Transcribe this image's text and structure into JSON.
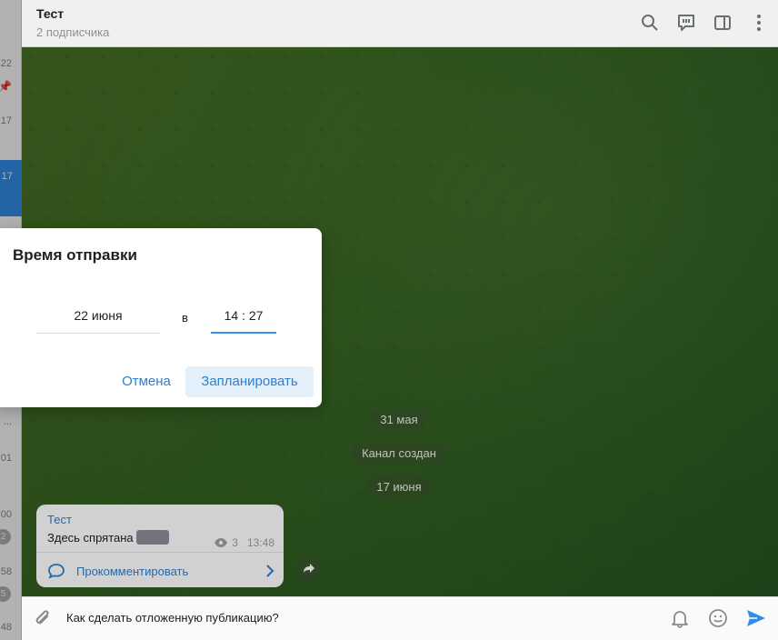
{
  "chat_list_strip": {
    "items": [
      {
        "time": "22"
      },
      {
        "time": "17"
      },
      {
        "time": "17",
        "active": true
      },
      {
        "time": "..."
      },
      {
        "time": "01"
      },
      {
        "time": "00",
        "badge": "2"
      },
      {
        "time": "58",
        "badge": "5"
      },
      {
        "time": "48"
      }
    ]
  },
  "header": {
    "title": "Тест",
    "subtitle": "2 подписчика",
    "icons": [
      "search-icon",
      "discussion-icon",
      "sidebar-toggle-icon",
      "more-icon"
    ]
  },
  "chat": {
    "service_messages": [
      "31 мая",
      "Канал создан",
      "17 июня"
    ],
    "message": {
      "author": "Тест",
      "text": "Здесь спрятана",
      "views": "3",
      "time": "13:48",
      "comment_label": "Прокомментировать"
    }
  },
  "composer": {
    "text": "Как сделать отложенную публикацию?"
  },
  "dialog": {
    "title": "Время отправки",
    "date": "22 июня",
    "at": "в",
    "time": "14 : 27",
    "cancel": "Отмена",
    "confirm": "Запланировать"
  },
  "colors": {
    "accent": "#3390ec",
    "link": "#2f7fd1",
    "confirm_bg": "#e3eff9"
  }
}
